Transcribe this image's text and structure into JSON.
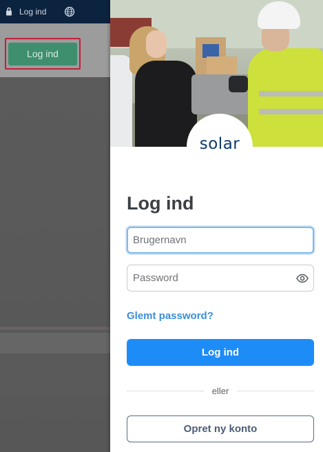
{
  "background": {
    "topbar": {
      "login_text": "Log ind"
    },
    "header_button": {
      "label": "Log ind"
    }
  },
  "login": {
    "logo_text": "solar",
    "title": "Log ind",
    "username_placeholder": "Brugernavn",
    "password_placeholder": "Password",
    "forgot_label": "Glemt password?",
    "submit_label": "Log ind",
    "divider_text": "eller",
    "create_account_label": "Opret ny konto"
  },
  "colors": {
    "primary_button": "#1e8cf6",
    "link": "#3a8fd9",
    "brand_navy": "#0c2340",
    "bg_button_green": "#3d8f6e",
    "highlight_frame": "#c2203c"
  },
  "icons": {
    "lock": "lock-icon",
    "globe": "globe-icon",
    "eye": "eye-icon"
  }
}
